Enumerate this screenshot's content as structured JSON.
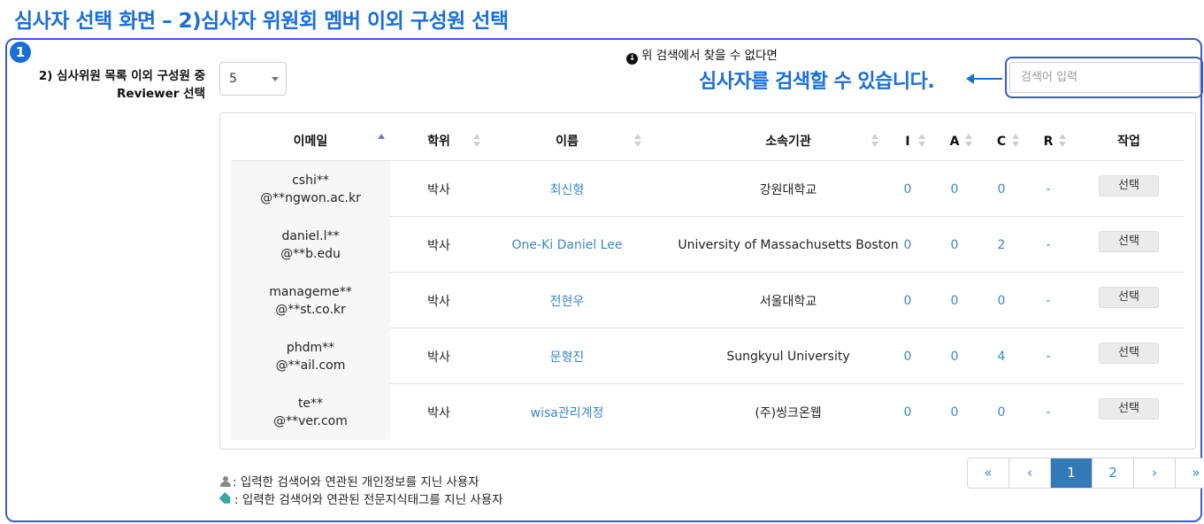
{
  "page_title": "심사자 선택 화면 – 2)심사자 위원회 멤버 이외 구성원 선택",
  "step_number": "1",
  "field_label_line1": "2) 심사위원 목록 이외 구성원 중",
  "field_label_line2": "Reviewer 선택",
  "page_size_value": "5",
  "notice_text": "위 검색에서 찾을 수 없다면",
  "callout_text": "심사자를 검색할 수 있습니다.",
  "search": {
    "placeholder": "검색어 입력"
  },
  "columns": [
    "이메일",
    "학위",
    "이름",
    "소속기관",
    "I",
    "A",
    "C",
    "R",
    "작업"
  ],
  "rows": [
    {
      "email1": "cshi**",
      "email2": "@**ngwon.ac.kr",
      "degree": "박사",
      "name": "최신형",
      "affiliation": "강원대학교",
      "i": "0",
      "a": "0",
      "c": "0",
      "r": "-",
      "action": "선택"
    },
    {
      "email1": "daniel.l**",
      "email2": "@**b.edu",
      "degree": "박사",
      "name": "One-Ki Daniel Lee",
      "affiliation": "University of Massachusetts Boston",
      "i": "0",
      "a": "0",
      "c": "2",
      "r": "-",
      "action": "선택"
    },
    {
      "email1": "manageme**",
      "email2": "@**st.co.kr",
      "degree": "박사",
      "name": "전현우",
      "affiliation": "서울대학교",
      "i": "0",
      "a": "0",
      "c": "0",
      "r": "-",
      "action": "선택"
    },
    {
      "email1": "phdm**",
      "email2": "@**ail.com",
      "degree": "박사",
      "name": "문형진",
      "affiliation": "Sungkyul University",
      "i": "0",
      "a": "0",
      "c": "4",
      "r": "-",
      "action": "선택"
    },
    {
      "email1": "te**",
      "email2": "@**ver.com",
      "degree": "박사",
      "name": "wisa관리계정",
      "affiliation": "(주)씽크온웹",
      "i": "0",
      "a": "0",
      "c": "0",
      "r": "-",
      "action": "선택"
    }
  ],
  "pagination": {
    "first": "«",
    "prev": "‹",
    "pages": [
      "1",
      "2"
    ],
    "next": "›",
    "last": "»",
    "current": "1"
  },
  "legend": {
    "personal": ": 입력한 검색어와 연관된 개인정보를 지닌 사용자",
    "tag": ": 입력한 검색어와 연관된 전문지식태그를 지닌 사용자"
  },
  "colors": {
    "accent": "#1a6fd6",
    "frame": "#3b5bd1",
    "link": "#3a87c8",
    "active_page": "#337ab7"
  }
}
